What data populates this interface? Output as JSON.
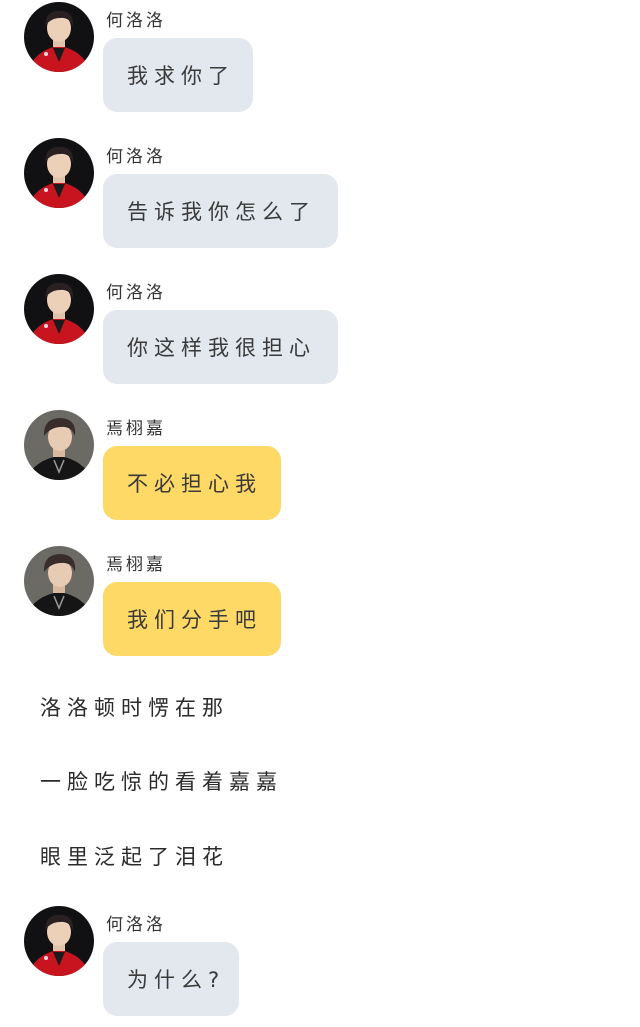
{
  "conversation": {
    "messages": [
      {
        "sender": "何洛洛",
        "text": "我求你了",
        "avatar": "avatar-red-jacket",
        "bubble_color": "#e3e8ef"
      },
      {
        "sender": "何洛洛",
        "text": "告诉我你怎么了",
        "avatar": "avatar-red-jacket",
        "bubble_color": "#e3e8ef"
      },
      {
        "sender": "何洛洛",
        "text": "你这样我很担心",
        "avatar": "avatar-red-jacket",
        "bubble_color": "#e3e8ef"
      },
      {
        "sender": "焉栩嘉",
        "text": "不必担心我",
        "avatar": "avatar-black-shirt",
        "bubble_color": "#ffd966"
      },
      {
        "sender": "焉栩嘉",
        "text": "我们分手吧",
        "avatar": "avatar-black-shirt",
        "bubble_color": "#ffd966"
      }
    ],
    "narration": [
      "洛洛顿时愣在那",
      "一脸吃惊的看着嘉嘉",
      "眼里泛起了泪花"
    ],
    "final_message": {
      "sender": "何洛洛",
      "text": "为什么?",
      "avatar": "avatar-red-jacket",
      "bubble_color": "#e3e8ef"
    }
  }
}
